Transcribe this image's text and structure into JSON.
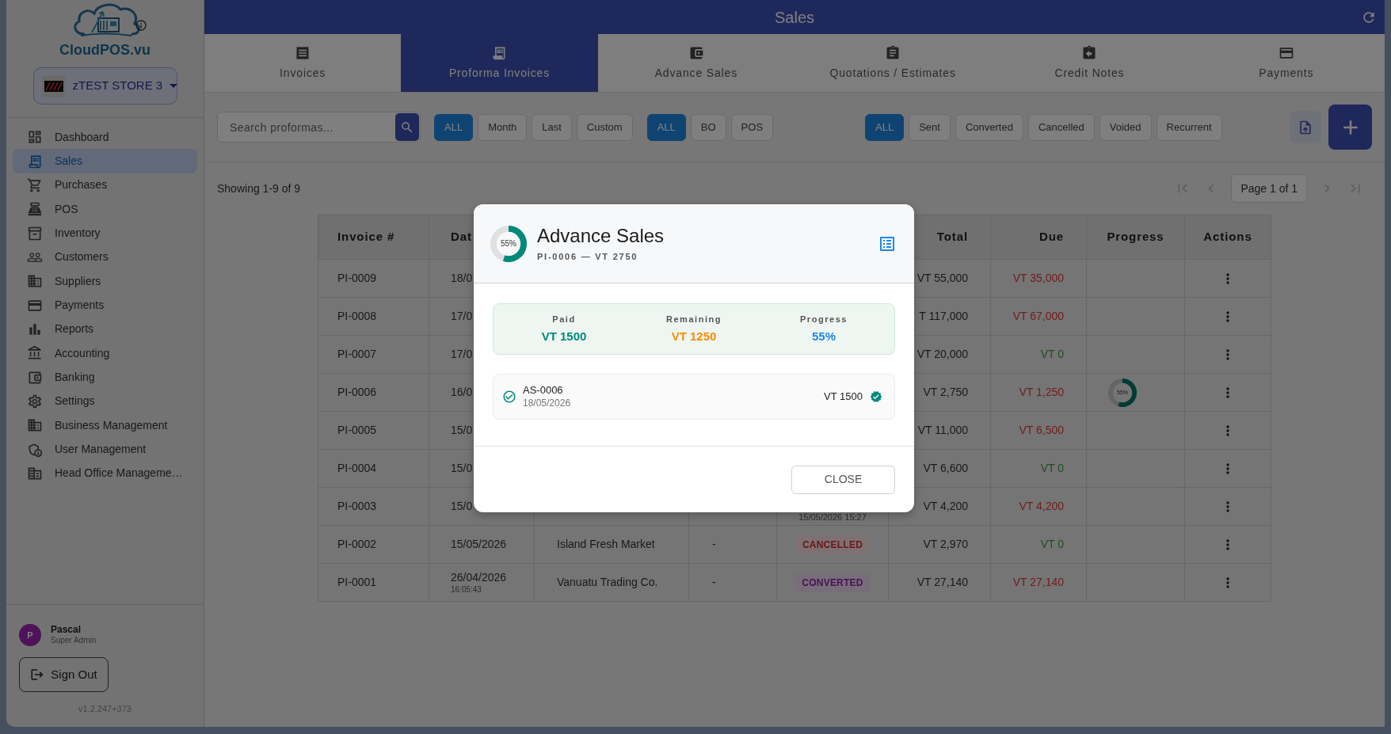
{
  "sidebar": {
    "logo_text": "CloudPOS.vu",
    "store": {
      "name": "zTEST STORE 3"
    },
    "nav": [
      {
        "label": "Dashboard",
        "selected": false
      },
      {
        "label": "Sales",
        "selected": true
      },
      {
        "label": "Purchases",
        "selected": false
      },
      {
        "label": "POS",
        "selected": false
      },
      {
        "label": "Inventory",
        "selected": false
      },
      {
        "label": "Customers",
        "selected": false
      },
      {
        "label": "Suppliers",
        "selected": false
      },
      {
        "label": "Payments",
        "selected": false
      },
      {
        "label": "Reports",
        "selected": false
      },
      {
        "label": "Accounting",
        "selected": false
      },
      {
        "label": "Banking",
        "selected": false
      },
      {
        "label": "Settings",
        "selected": false
      },
      {
        "label": "Business Management",
        "selected": false
      },
      {
        "label": "User Management",
        "selected": false
      },
      {
        "label": "Head Office Manageme…",
        "selected": false
      }
    ],
    "user": {
      "initial": "P",
      "name": "Pascal",
      "role": "Super Admin"
    },
    "sign_out": "Sign Out",
    "version": "v1.2.247+373"
  },
  "header": {
    "title": "Sales"
  },
  "tabs": [
    {
      "label": "Invoices",
      "selected": false
    },
    {
      "label": "Proforma Invoices",
      "selected": true
    },
    {
      "label": "Advance Sales",
      "selected": false
    },
    {
      "label": "Quotations / Estimates",
      "selected": false
    },
    {
      "label": "Credit Notes",
      "selected": false
    },
    {
      "label": "Payments",
      "selected": false
    }
  ],
  "filters": {
    "search": {
      "placeholder": "Search proformas..."
    },
    "groups": [
      {
        "chips": [
          {
            "label": "ALL",
            "selected": true
          },
          {
            "label": "Month",
            "selected": false
          },
          {
            "label": "Last",
            "selected": false
          },
          {
            "label": "Custom",
            "selected": false
          }
        ]
      },
      {
        "chips": [
          {
            "label": "ALL",
            "selected": true
          },
          {
            "label": "BO",
            "selected": false
          },
          {
            "label": "POS",
            "selected": false
          }
        ]
      },
      {
        "chips": [
          {
            "label": "ALL",
            "selected": true
          },
          {
            "label": "Sent",
            "selected": false
          },
          {
            "label": "Converted",
            "selected": false
          },
          {
            "label": "Cancelled",
            "selected": false
          },
          {
            "label": "Voided",
            "selected": false
          },
          {
            "label": "Recurrent",
            "selected": false
          }
        ]
      }
    ]
  },
  "summary": "Showing 1-9 of 9",
  "pagination": {
    "label": "Page 1 of 1",
    "buttons": [
      {
        "kind": "first",
        "disabled": true
      },
      {
        "kind": "prev",
        "disabled": true
      },
      {
        "kind": "next",
        "disabled": true
      },
      {
        "kind": "last",
        "disabled": true
      }
    ]
  },
  "table": {
    "columns": {
      "invoice_number": "Invoice #",
      "column_2": "Dat",
      "total": "Total",
      "due": "Due",
      "progress": "Progress",
      "actions": "Actions"
    },
    "rows": [
      {
        "invoice_number": "PI-0009",
        "column_2": "18/0",
        "total": "VT 55,000",
        "due": "VT 35,000",
        "settled": false
      },
      {
        "invoice_number": "PI-0008",
        "column_2": "17/0",
        "total": "T 117,000",
        "due": "VT 67,000",
        "settled": false
      },
      {
        "invoice_number": "PI-0007",
        "column_2": "17/0",
        "total": "VT 20,000",
        "due": "VT 0",
        "settled": true
      },
      {
        "invoice_number": "PI-0006",
        "column_2": "16/0",
        "total": "VT 2,750",
        "due": "VT 1,250",
        "settled": false,
        "progress": {
          "level": 0.55,
          "label": "55%"
        }
      },
      {
        "invoice_number": "PI-0005",
        "column_2": "15/0",
        "total": "VT 11,000",
        "due": "VT 6,500",
        "settled": false
      },
      {
        "invoice_number": "PI-0004",
        "column_2": "15/0",
        "total": "VT 6,600",
        "due": "VT 0",
        "settled": true
      },
      {
        "invoice_number": "PI-0003",
        "column_2": "15/0",
        "column_5": {
          "note": "15/05/2026 15:27"
        },
        "total": "VT 4,200",
        "due": "VT 4,200",
        "settled": false
      },
      {
        "invoice_number": "PI-0002",
        "column_2": "15/05/2026",
        "column_3": "Island Fresh Market",
        "column_4": "-",
        "column_5": {
          "label": "CANCELLED",
          "kind": "cancelled"
        },
        "total": "VT 2,970",
        "due": "VT 0",
        "settled": true
      },
      {
        "invoice_number": "PI-0001",
        "column_2": "26/04/2026",
        "column_2_sub": "16:05:43",
        "column_3": "Vanuatu Trading Co.",
        "column_4": "-",
        "column_5": {
          "label": "CONVERTED",
          "kind": "converted"
        },
        "total": "VT 27,140",
        "due": "VT 27,140",
        "settled": false
      }
    ]
  },
  "modal": {
    "title": "Advance Sales",
    "subtitle": "PI-0006 — VT 2750",
    "progress": {
      "level": 0.55,
      "label": "55%"
    },
    "stats": [
      {
        "label": "Paid",
        "value": "VT 1500",
        "kind": "paid"
      },
      {
        "label": "Remaining",
        "value": "VT 1250",
        "kind": "remaining"
      },
      {
        "label": "Progress",
        "value": "55%",
        "kind": "progress"
      }
    ],
    "payments": [
      {
        "reference": "AS-0006",
        "date": "18/05/2026",
        "amount": "VT 1500",
        "verified": true
      }
    ],
    "close_button": "CLOSE"
  }
}
